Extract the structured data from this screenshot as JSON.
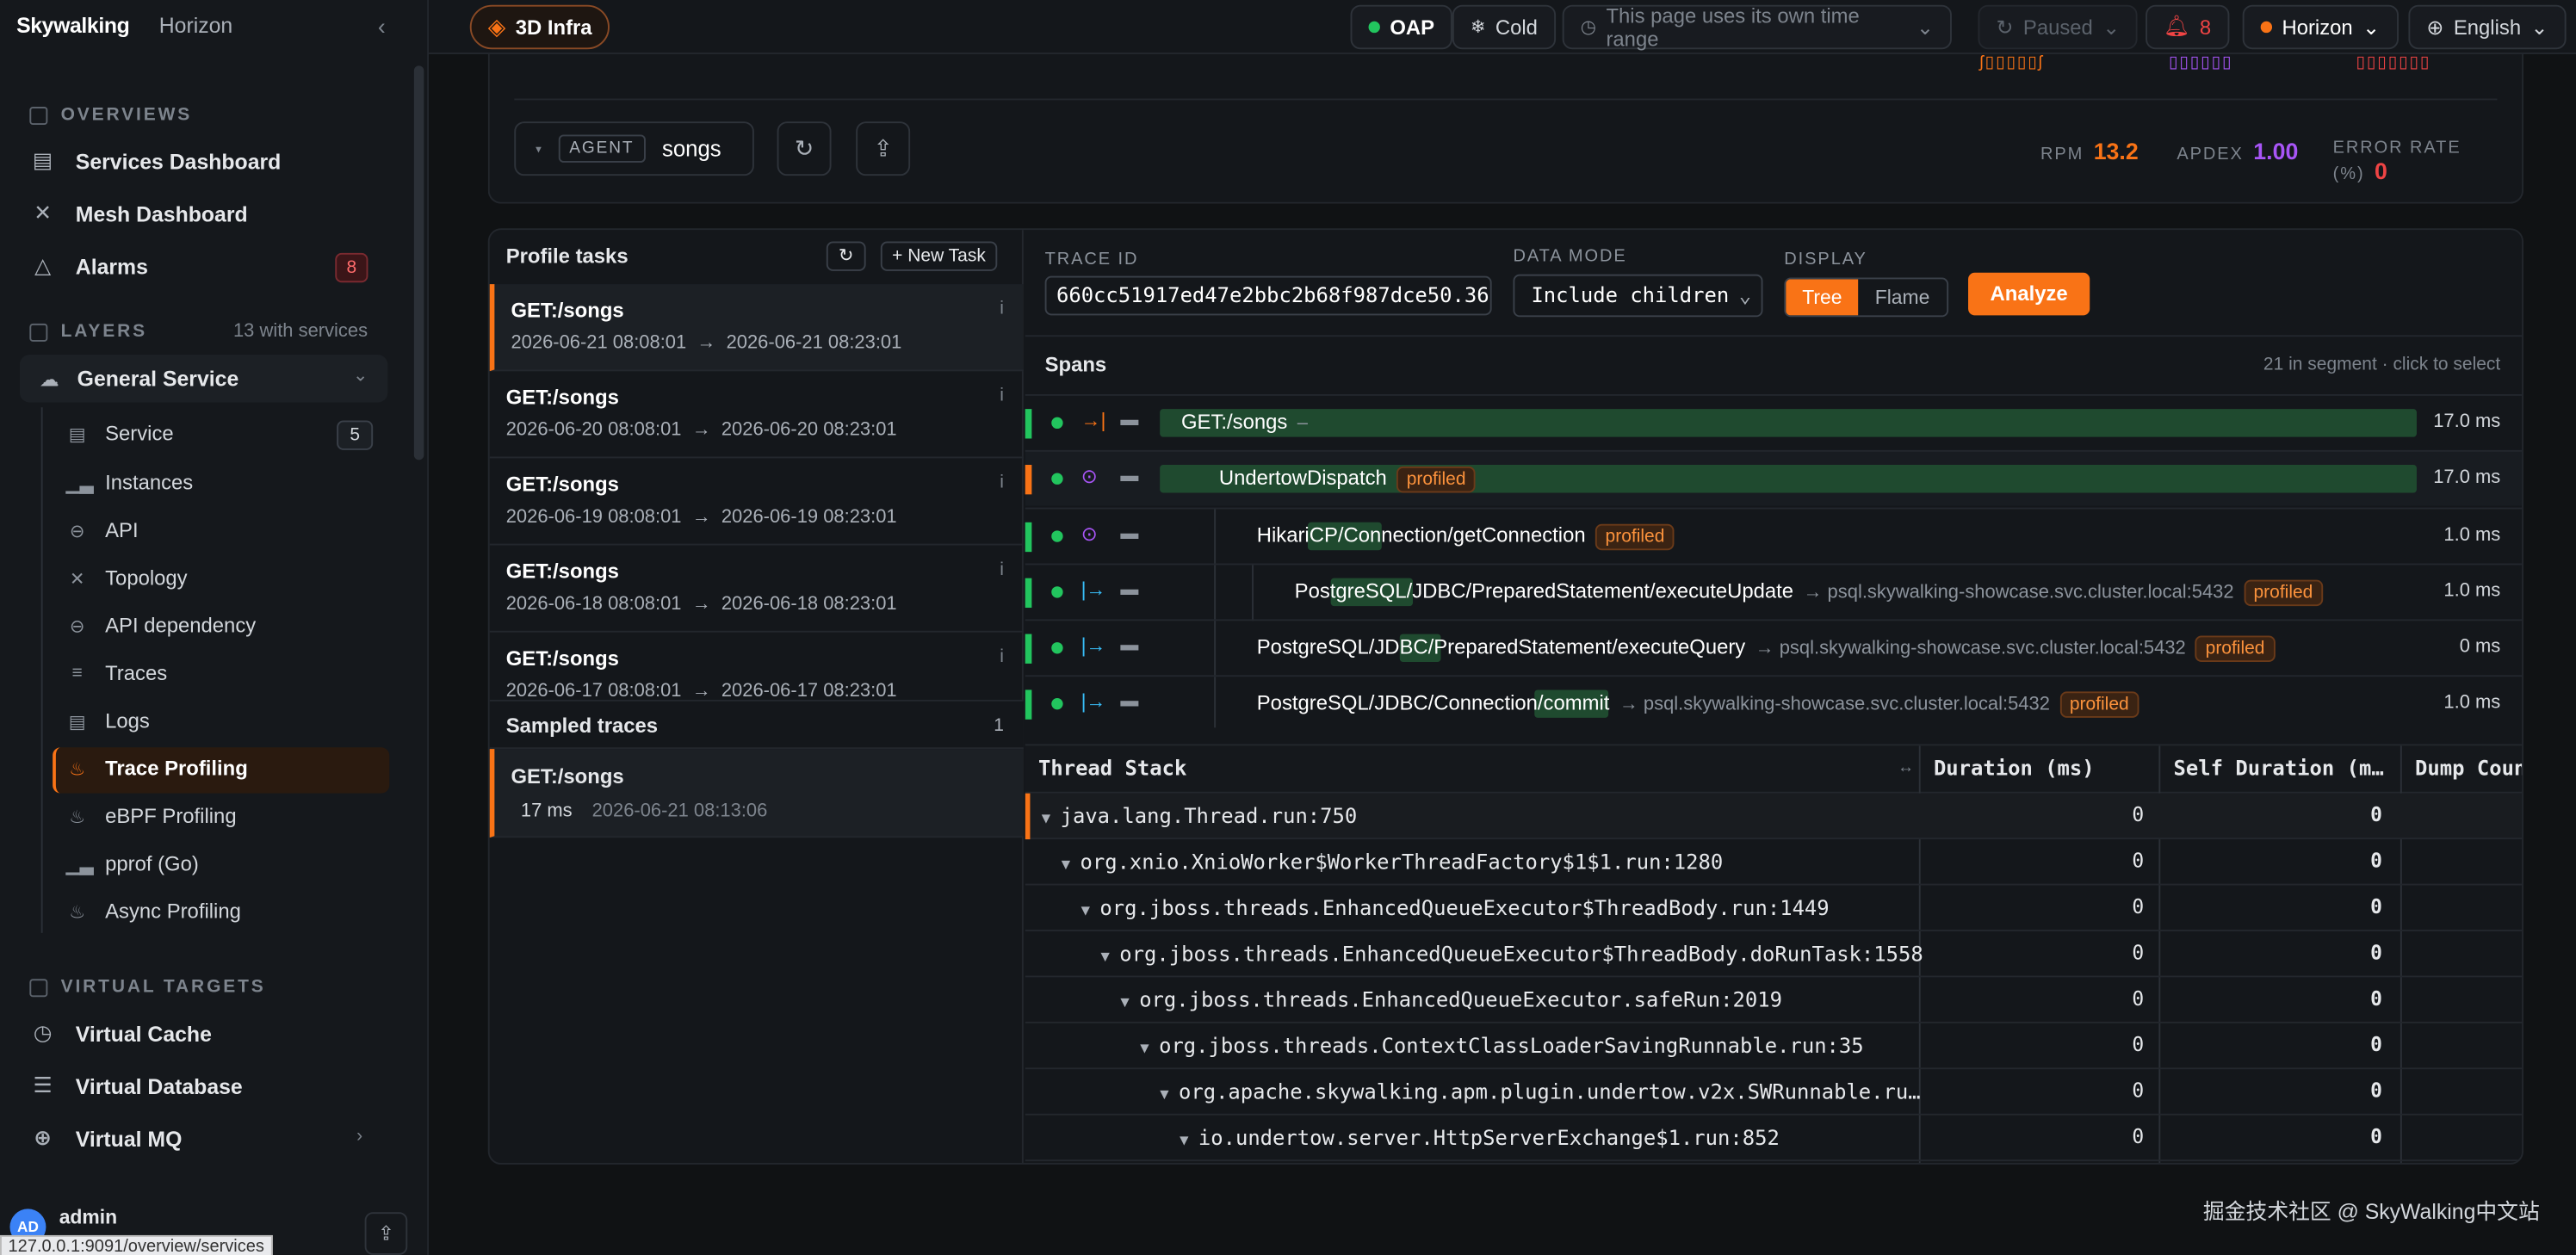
{
  "brand": {
    "logo": "Skywalking",
    "instance": "Horizon",
    "collapse_icon": "chevron-left-icon"
  },
  "sidebar": {
    "overviews_title": "OVERVIEWS",
    "overviews": [
      {
        "label": "Services Dashboard",
        "icon": "dashboard-icon"
      },
      {
        "label": "Mesh Dashboard",
        "icon": "mesh-icon"
      },
      {
        "label": "Alarms",
        "icon": "alarm-icon",
        "badge": "8"
      }
    ],
    "layers_title": "LAYERS",
    "layers_count": "13 with services",
    "general_service": "General Service",
    "subitems": [
      {
        "label": "Service",
        "count": "5"
      },
      {
        "label": "Instances"
      },
      {
        "label": "API"
      },
      {
        "label": "Topology"
      },
      {
        "label": "API dependency"
      },
      {
        "label": "Traces"
      },
      {
        "label": "Logs"
      },
      {
        "label": "Trace Profiling"
      },
      {
        "label": "eBPF Profiling"
      },
      {
        "label": "pprof (Go)"
      },
      {
        "label": "Async Profiling"
      }
    ],
    "virtual_title": "VIRTUAL TARGETS",
    "virtual": [
      {
        "label": "Virtual Cache"
      },
      {
        "label": "Virtual Database"
      },
      {
        "label": "Virtual MQ"
      }
    ],
    "user": {
      "initials": "AD",
      "name": "admin"
    },
    "url": "127.0.0.1:9091/overview/services"
  },
  "topbar": {
    "infra": "3D Infra",
    "oap": "OAP",
    "cold": "Cold",
    "time_range": "This page uses its own time range",
    "paused": "Paused",
    "alarm_count": "8",
    "instance": "Horizon",
    "language": "English"
  },
  "agent": {
    "tag": "AGENT",
    "value": "songs"
  },
  "metrics": {
    "rpm_label": "RPM",
    "rpm": "13.2",
    "apdex_label": "APDEX",
    "apdex": "1.00",
    "error_label": "ERROR RATE (%)",
    "error": "0"
  },
  "profile": {
    "title": "Profile tasks",
    "new_task": "+ New Task",
    "tasks": [
      {
        "name": "GET:/songs",
        "start": "2026-06-21 08:08:01",
        "end": "2026-06-21 08:23:01"
      },
      {
        "name": "GET:/songs",
        "start": "2026-06-20 08:08:01",
        "end": "2026-06-20 08:23:01"
      },
      {
        "name": "GET:/songs",
        "start": "2026-06-19 08:08:01",
        "end": "2026-06-19 08:23:01"
      },
      {
        "name": "GET:/songs",
        "start": "2026-06-18 08:08:01",
        "end": "2026-06-18 08:23:01"
      },
      {
        "name": "GET:/songs",
        "start": "2026-06-17 08:08:01",
        "end": "2026-06-17 08:23:01"
      }
    ],
    "sampled_title": "Sampled traces",
    "sampled_count": "1",
    "sampled": {
      "name": "GET:/songs",
      "dur": "17 ms",
      "time": "2026-06-21 08:13:06"
    }
  },
  "controls": {
    "trace_id_label": "TRACE ID",
    "trace_id": "660cc51917ed47e2bbc2b68f987dce50.36.",
    "data_mode_label": "DATA MODE",
    "data_mode": "Include children",
    "display_label": "DISPLAY",
    "display_tree": "Tree",
    "display_flame": "Flame",
    "analyze": "Analyze"
  },
  "spans": {
    "title": "Spans",
    "summary": "21 in segment · click to select",
    "rows": [
      {
        "name": "GET:/songs",
        "peer": "",
        "profiled": "",
        "dur": "17.0 ms",
        "kind": "→|"
      },
      {
        "name": "UndertowDispatch",
        "peer": "",
        "profiled": "profiled",
        "dur": "17.0 ms",
        "kind": "⊙"
      },
      {
        "name": "HikariCP/Connection/getConnection",
        "peer": "",
        "profiled": "profiled",
        "dur": "1.0 ms",
        "kind": "⊙"
      },
      {
        "name": "PostgreSQL/JDBC/PreparedStatement/executeUpdate",
        "peer": "→ psql.skywalking-showcase.svc.cluster.local:5432",
        "profiled": "profiled",
        "dur": "1.0 ms",
        "kind": "|→"
      },
      {
        "name": "PostgreSQL/JDBC/PreparedStatement/executeQuery",
        "peer": "→ psql.skywalking-showcase.svc.cluster.local:5432",
        "profiled": "profiled",
        "dur": "0 ms",
        "kind": "|→"
      },
      {
        "name": "PostgreSQL/JDBC/Connection/commit",
        "peer": "→ psql.skywalking-showcase.svc.cluster.local:5432",
        "profiled": "profiled",
        "dur": "1.0 ms",
        "kind": "|→"
      }
    ]
  },
  "thread": {
    "headers": {
      "stack": "Thread Stack",
      "dur": "Duration (ms)",
      "self": "Self Duration (m…",
      "dump": "Dump Coun"
    },
    "rows": [
      {
        "fn": "java.lang.Thread.run:750",
        "dur": "0",
        "self": "0"
      },
      {
        "fn": "org.xnio.XnioWorker$WorkerThreadFactory$1$1.run:1280",
        "dur": "0",
        "self": "0"
      },
      {
        "fn": "org.jboss.threads.EnhancedQueueExecutor$ThreadBody.run:1449",
        "dur": "0",
        "self": "0"
      },
      {
        "fn": "org.jboss.threads.EnhancedQueueExecutor$ThreadBody.doRunTask:1558",
        "dur": "0",
        "self": "0"
      },
      {
        "fn": "org.jboss.threads.EnhancedQueueExecutor.safeRun:2019",
        "dur": "0",
        "self": "0"
      },
      {
        "fn": "org.jboss.threads.ContextClassLoaderSavingRunnable.run:35",
        "dur": "0",
        "self": "0"
      },
      {
        "fn": "org.apache.skywalking.apm.plugin.undertow.v2x.SWRunnable.ru…",
        "dur": "0",
        "self": "0"
      },
      {
        "fn": "io.undertow.server.HttpServerExchange$1.run:852",
        "dur": "0",
        "self": "0"
      }
    ]
  },
  "watermark": "掘金技术社区 @ SkyWalking中文站",
  "colors": {
    "accent": "#f97316",
    "green": "#22c55e",
    "purple": "#a855f7",
    "red": "#ef4444"
  }
}
